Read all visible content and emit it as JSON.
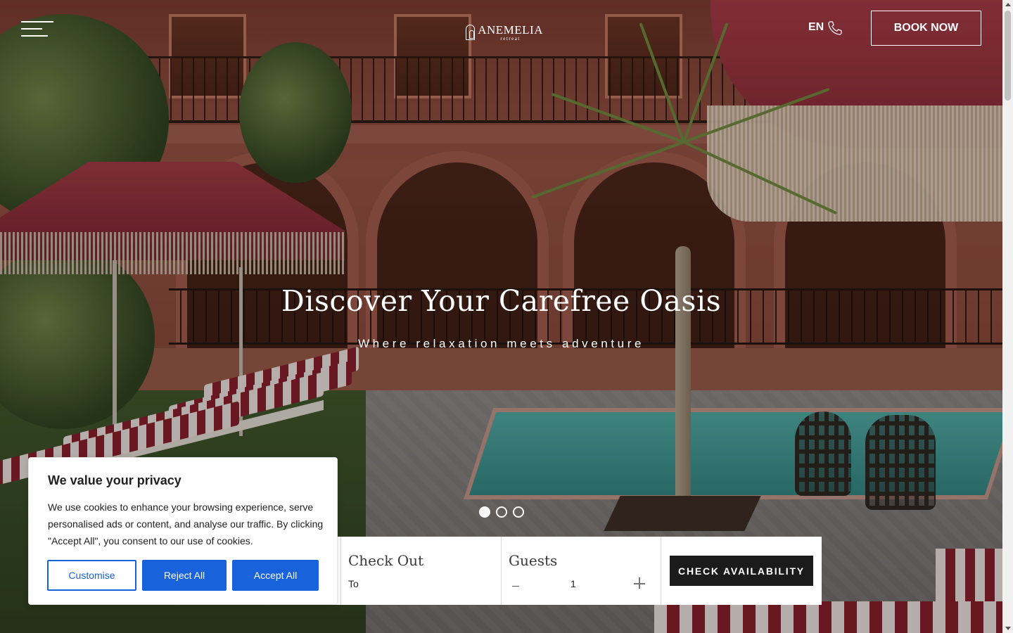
{
  "header": {
    "logo_name": "ANEMELIA",
    "logo_sub": "retreat",
    "language": "EN",
    "book_now": "BOOK NOW"
  },
  "hero": {
    "headline": "Discover Your Carefree Oasis",
    "tagline": "Where relaxation meets adventure",
    "slides": {
      "count": 3,
      "active": 1
    }
  },
  "booking": {
    "check_out_title": "Check Out",
    "check_out_value": "To",
    "guests_title": "Guests",
    "guests_count": "1",
    "check_availability": "CHECK AVAILABILITY"
  },
  "cookie_banner": {
    "title": "We value your privacy",
    "text": "We use cookies to enhance your browsing experience, serve personalised ads or content, and analyse our traffic. By clicking \"Accept All\", you consent to our use of cookies.",
    "customise": "Customise",
    "reject_all": "Reject All",
    "accept_all": "Accept All"
  },
  "icons": {
    "menu": "hamburger-menu-icon",
    "phone": "phone-icon",
    "logo": "arch-logo-icon",
    "minus": "minus-icon",
    "plus": "plus-icon"
  },
  "colors": {
    "accent_blue": "#1863dc",
    "dark_button": "#1b1b1b"
  }
}
